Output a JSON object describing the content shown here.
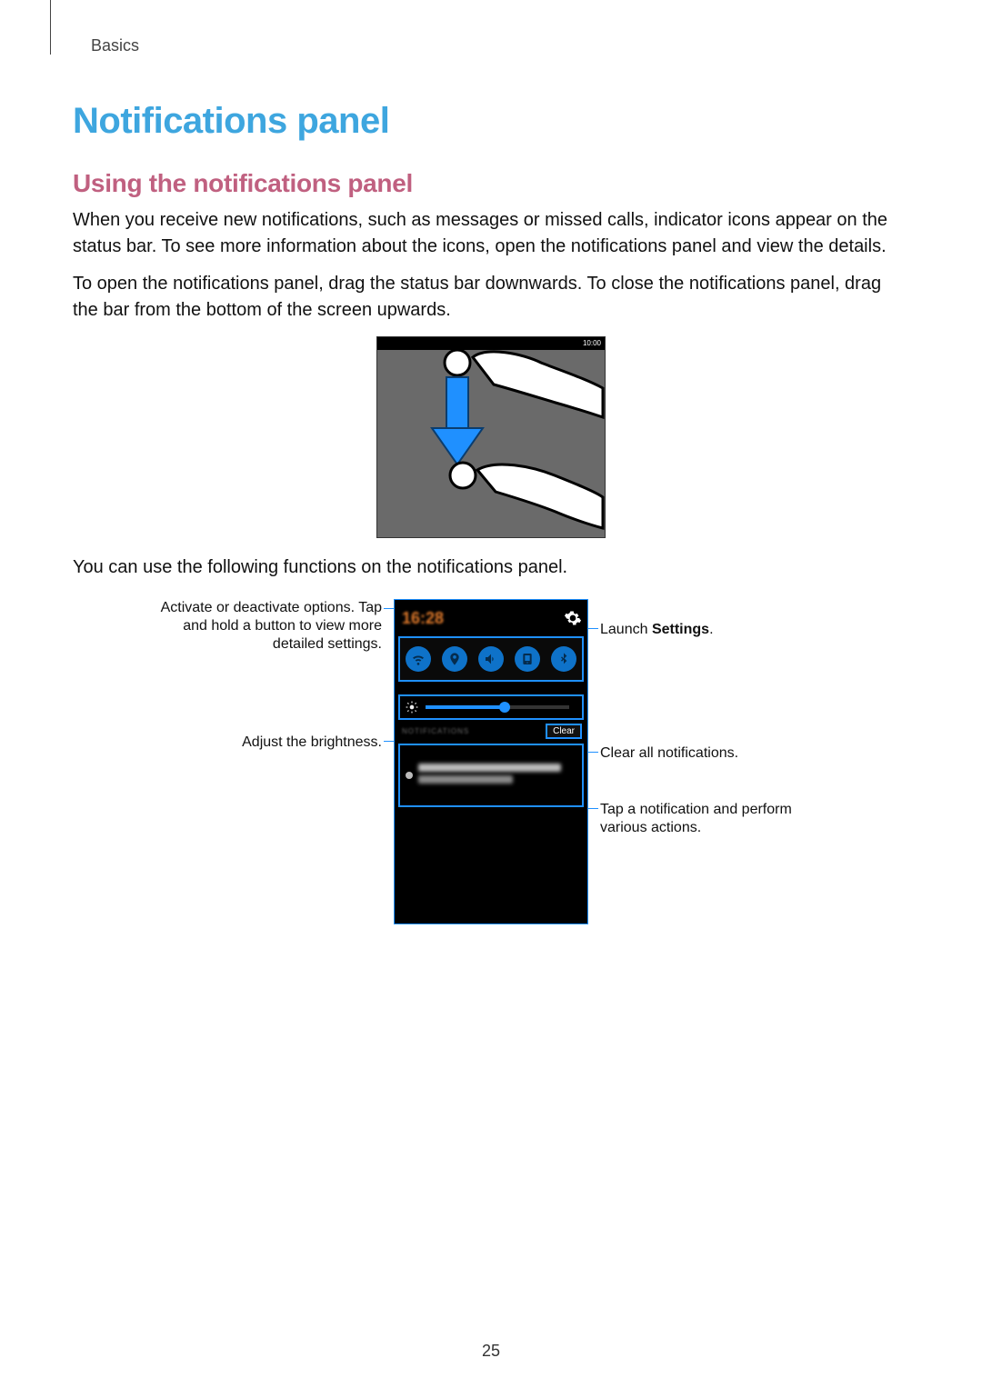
{
  "section": "Basics",
  "title": "Notifications panel",
  "subheading": "Using the notifications panel",
  "para1": "When you receive new notifications, such as messages or missed calls, indicator icons appear on the status bar. To see more information about the icons, open the notifications panel and view the details.",
  "para2": "To open the notifications panel, drag the status bar downwards. To close the notifications panel, drag the bar from the bottom of the screen upwards.",
  "fig1_time": "10:00",
  "para3": "You can use the following functions on the notifications panel.",
  "panel": {
    "time": "16:28",
    "clear_label": "Clear",
    "notif_label": "NOTIFICATIONS"
  },
  "callouts": {
    "toggles": "Activate or deactivate options. Tap and hold a button to view more detailed settings.",
    "brightness": "Adjust the brightness.",
    "settings_prefix": "Launch ",
    "settings_bold": "Settings",
    "settings_suffix": ".",
    "clear": "Clear all notifications.",
    "tap": "Tap a notification and perform various actions."
  },
  "page_number": "25"
}
